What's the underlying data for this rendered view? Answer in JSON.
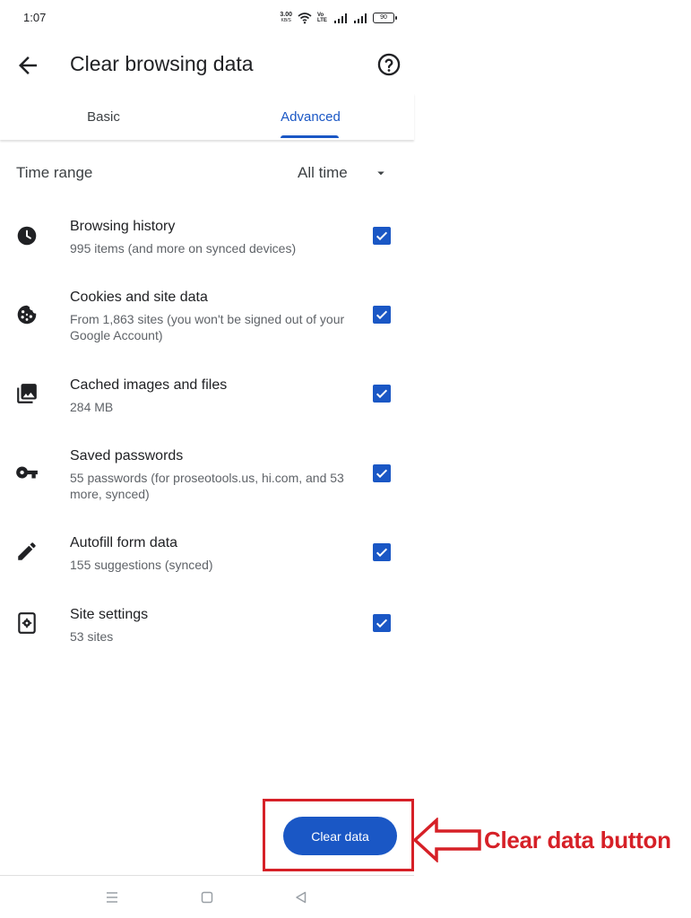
{
  "status_bar": {
    "time": "1:07",
    "net_speed_value": "3.00",
    "net_speed_unit": "KB/S",
    "volte_label": "Vo LTE",
    "battery_level": "90"
  },
  "header": {
    "title": "Clear browsing data"
  },
  "tabs": [
    {
      "label": "Basic",
      "selected": false
    },
    {
      "label": "Advanced",
      "selected": true
    }
  ],
  "time_range": {
    "label": "Time range",
    "value": "All time"
  },
  "items": [
    {
      "title": "Browsing history",
      "subtitle": "995 items (and more on synced devices)",
      "icon": "clock-icon",
      "checked": true
    },
    {
      "title": "Cookies and site data",
      "subtitle": "From 1,863 sites (you won't be signed out of your Google Account)",
      "icon": "cookie-icon",
      "checked": true
    },
    {
      "title": "Cached images and files",
      "subtitle": "284 MB",
      "icon": "image-icon",
      "checked": true
    },
    {
      "title": "Saved passwords",
      "subtitle": "55 passwords (for proseotools.us, hi.com, and 53 more, synced)",
      "icon": "key-icon",
      "checked": true
    },
    {
      "title": "Autofill form data",
      "subtitle": "155 suggestions (synced)",
      "icon": "pencil-icon",
      "checked": true
    },
    {
      "title": "Site settings",
      "subtitle": "53 sites",
      "icon": "site-settings-icon",
      "checked": true
    }
  ],
  "clear_button": {
    "label": "Clear data"
  },
  "annotation": {
    "label": "Clear data button",
    "color": "#d62027"
  },
  "colors": {
    "accent": "#1a57c5",
    "text_primary": "#202124",
    "text_secondary": "#5f6368"
  }
}
